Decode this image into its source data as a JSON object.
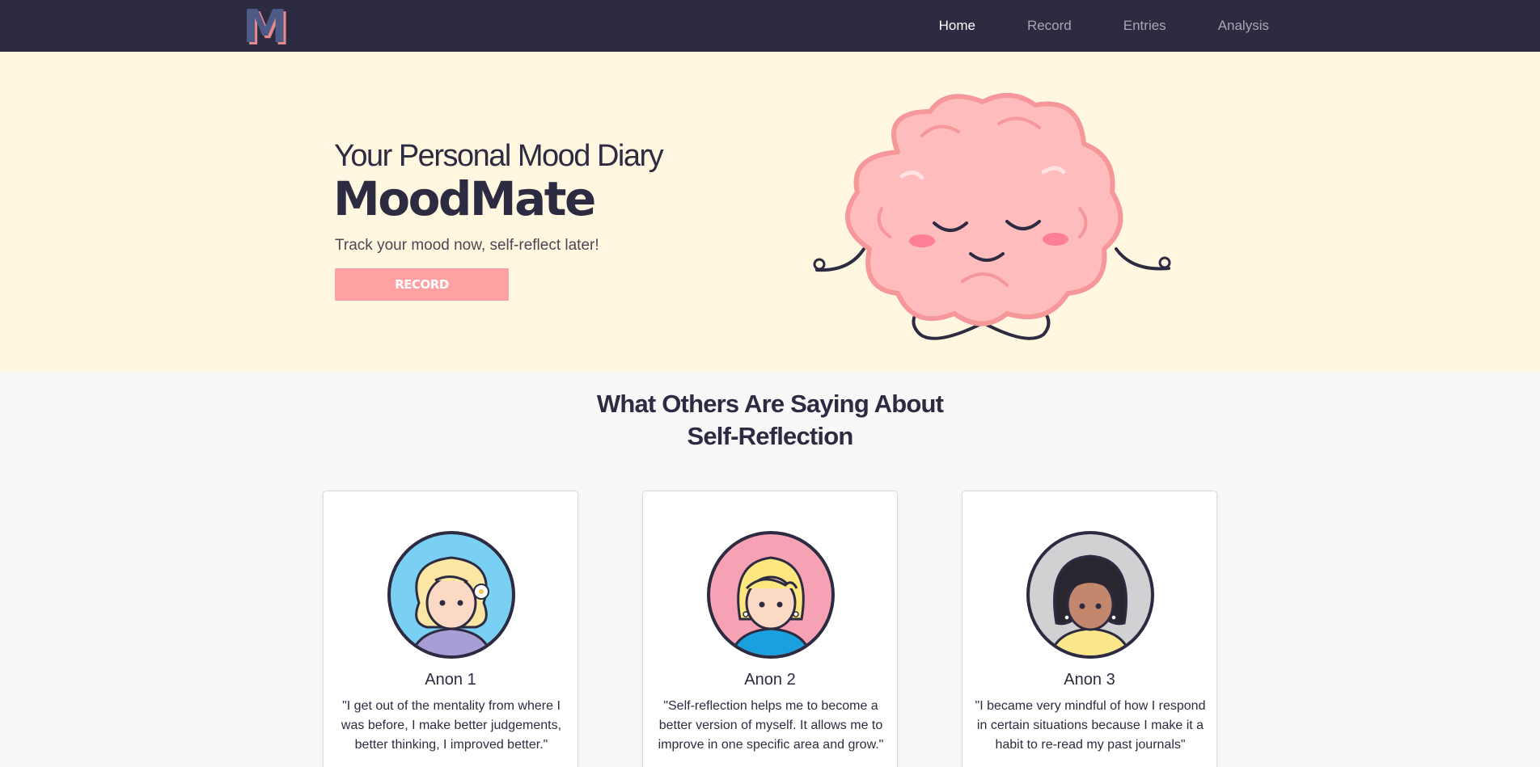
{
  "nav": {
    "logo_letter": "M",
    "links": [
      {
        "label": "Home",
        "active": true
      },
      {
        "label": "Record",
        "active": false
      },
      {
        "label": "Entries",
        "active": false
      },
      {
        "label": "Analysis",
        "active": false
      }
    ]
  },
  "hero": {
    "subtitle": "Your Personal Mood Diary",
    "title": "MoodMate",
    "tagline": "Track your mood now, self-reflect later!",
    "button_label": "RECORD",
    "illustration": "meditating-brain-illustration"
  },
  "testimonials": {
    "heading": "What Others Are Saying About Self-Reflection",
    "cards": [
      {
        "name": "Anon 1",
        "quote": "\"I get out of the mentality from where I was before, I make better judgements, better thinking, I improved better.\"",
        "avatar": "blonde-girl-flower-avatar"
      },
      {
        "name": "Anon 2",
        "quote": "\"Self-reflection helps me to become a better version of myself. It allows me to improve in one specific area and grow.\"",
        "avatar": "blonde-girl-blue-shirt-avatar"
      },
      {
        "name": "Anon 3",
        "quote": "\"I became very mindful of how I respond in certain situations because I make it a habit to re-read my past journals\"",
        "avatar": "dark-hair-girl-earrings-avatar"
      }
    ]
  },
  "colors": {
    "navbar_bg": "#2d2b41",
    "hero_bg": "#fff7df",
    "accent": "#ffa0a2",
    "page_bg": "#f8f8f8",
    "brain_pink": "#ffbcbd"
  }
}
